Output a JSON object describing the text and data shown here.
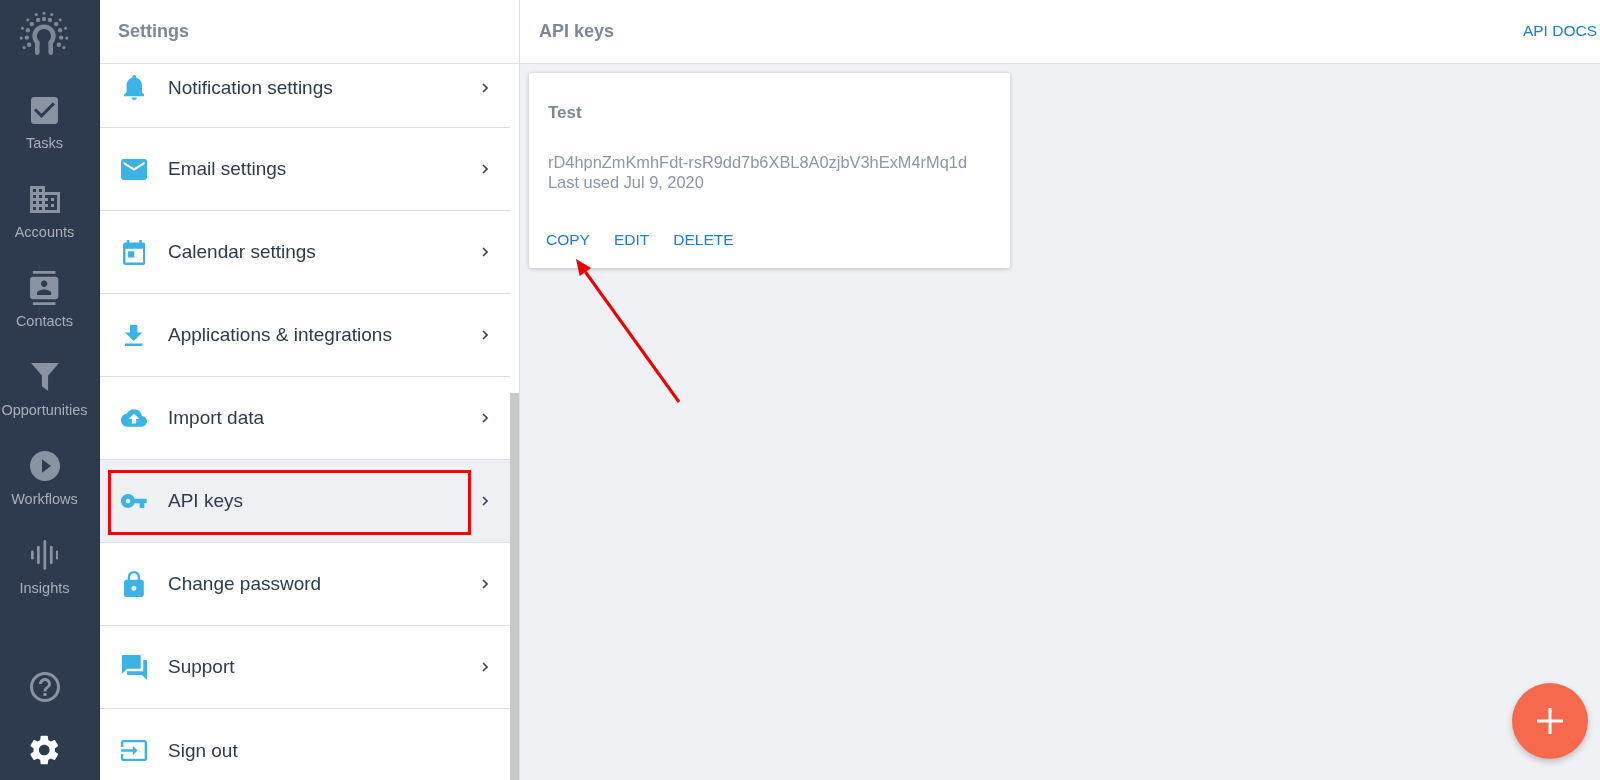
{
  "nav": {
    "items": [
      {
        "label": "Tasks",
        "selected": false
      },
      {
        "label": "Accounts",
        "selected": false
      },
      {
        "label": "Contacts",
        "selected": false
      },
      {
        "label": "Opportunities",
        "selected": false
      },
      {
        "label": "Workflows",
        "selected": false
      },
      {
        "label": "Insights",
        "selected": false
      }
    ],
    "footer_items": [
      {
        "selected": false
      },
      {
        "selected": true
      }
    ]
  },
  "settings": {
    "title": "Settings",
    "items": [
      {
        "label": "Notification settings",
        "kind": "submenu",
        "selected": false,
        "highlighted": false
      },
      {
        "label": "Email settings",
        "kind": "submenu",
        "selected": false,
        "highlighted": false
      },
      {
        "label": "Calendar settings",
        "kind": "submenu",
        "selected": false,
        "highlighted": false
      },
      {
        "label": "Applications & integrations",
        "kind": "submenu",
        "selected": false,
        "highlighted": false
      },
      {
        "label": "Import data",
        "kind": "submenu",
        "selected": false,
        "highlighted": false
      },
      {
        "label": "API keys",
        "kind": "submenu",
        "selected": true,
        "highlighted": true
      },
      {
        "label": "Change password",
        "kind": "submenu",
        "selected": false,
        "highlighted": false
      },
      {
        "label": "Support",
        "kind": "submenu",
        "selected": false,
        "highlighted": false
      },
      {
        "label": "Sign out",
        "kind": "action",
        "selected": false,
        "highlighted": false
      }
    ]
  },
  "header": {
    "title": "API keys",
    "link": "API DOCS"
  },
  "key_card": {
    "name": "Test",
    "key": "rD4hpnZmKmhFdt-rsR9dd7b6XBL8A0zjbV3hExM4rMq1d",
    "last_used": "Last used Jul 9, 2020",
    "actions": [
      {
        "label": "COPY",
        "arrow": true
      },
      {
        "label": "EDIT",
        "arrow": false
      },
      {
        "label": "DELETE",
        "arrow": false
      }
    ]
  }
}
